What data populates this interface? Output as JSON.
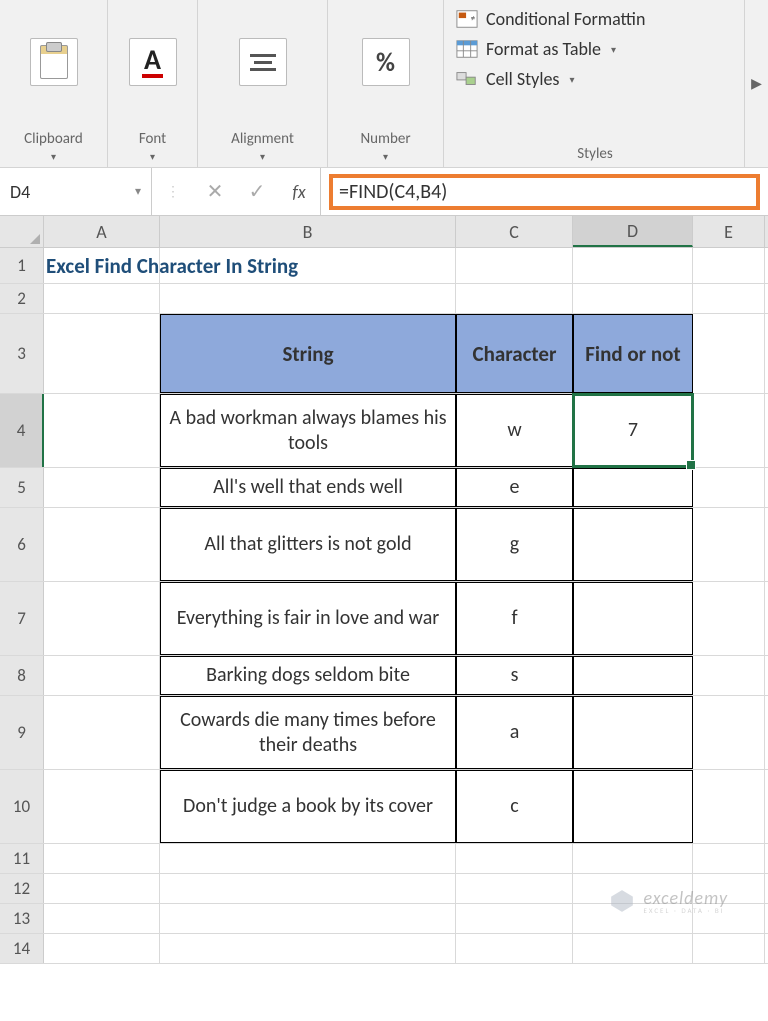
{
  "ribbon": {
    "clipboard": {
      "label": "Clipboard"
    },
    "font": {
      "label": "Font"
    },
    "alignment": {
      "label": "Alignment"
    },
    "number": {
      "label": "Number"
    },
    "styles": {
      "label": "Styles",
      "cond_fmt": "Conditional Formattin",
      "fmt_table": "Format as Table",
      "cell_styles": "Cell Styles"
    }
  },
  "formula_bar": {
    "name_box": "D4",
    "formula": "=FIND(C4,B4)"
  },
  "columns": {
    "A": "A",
    "B": "B",
    "C": "C",
    "D": "D",
    "E": "E"
  },
  "row_numbers": [
    "1",
    "2",
    "3",
    "4",
    "5",
    "6",
    "7",
    "8",
    "9",
    "10",
    "11",
    "12",
    "13",
    "14"
  ],
  "sheet": {
    "title": "Excel Find Character In String",
    "headers": {
      "string": "String",
      "char": "Character",
      "find": "Find or not"
    },
    "rows": [
      {
        "string": "A bad workman always blames his tools",
        "char": "w",
        "find": "7"
      },
      {
        "string": "All's well that ends well",
        "char": "e",
        "find": ""
      },
      {
        "string": "All that glitters is not gold",
        "char": "g",
        "find": ""
      },
      {
        "string": "Everything is fair in love and war",
        "char": "f",
        "find": ""
      },
      {
        "string": "Barking dogs seldom bite",
        "char": "s",
        "find": ""
      },
      {
        "string": "Cowards die many times before their deaths",
        "char": "a",
        "find": ""
      },
      {
        "string": "Don't judge a book by its cover",
        "char": "c",
        "find": ""
      }
    ]
  },
  "selected_cell": "D4",
  "watermark": {
    "main": "exceldemy",
    "sub": "EXCEL · DATA · BI"
  }
}
